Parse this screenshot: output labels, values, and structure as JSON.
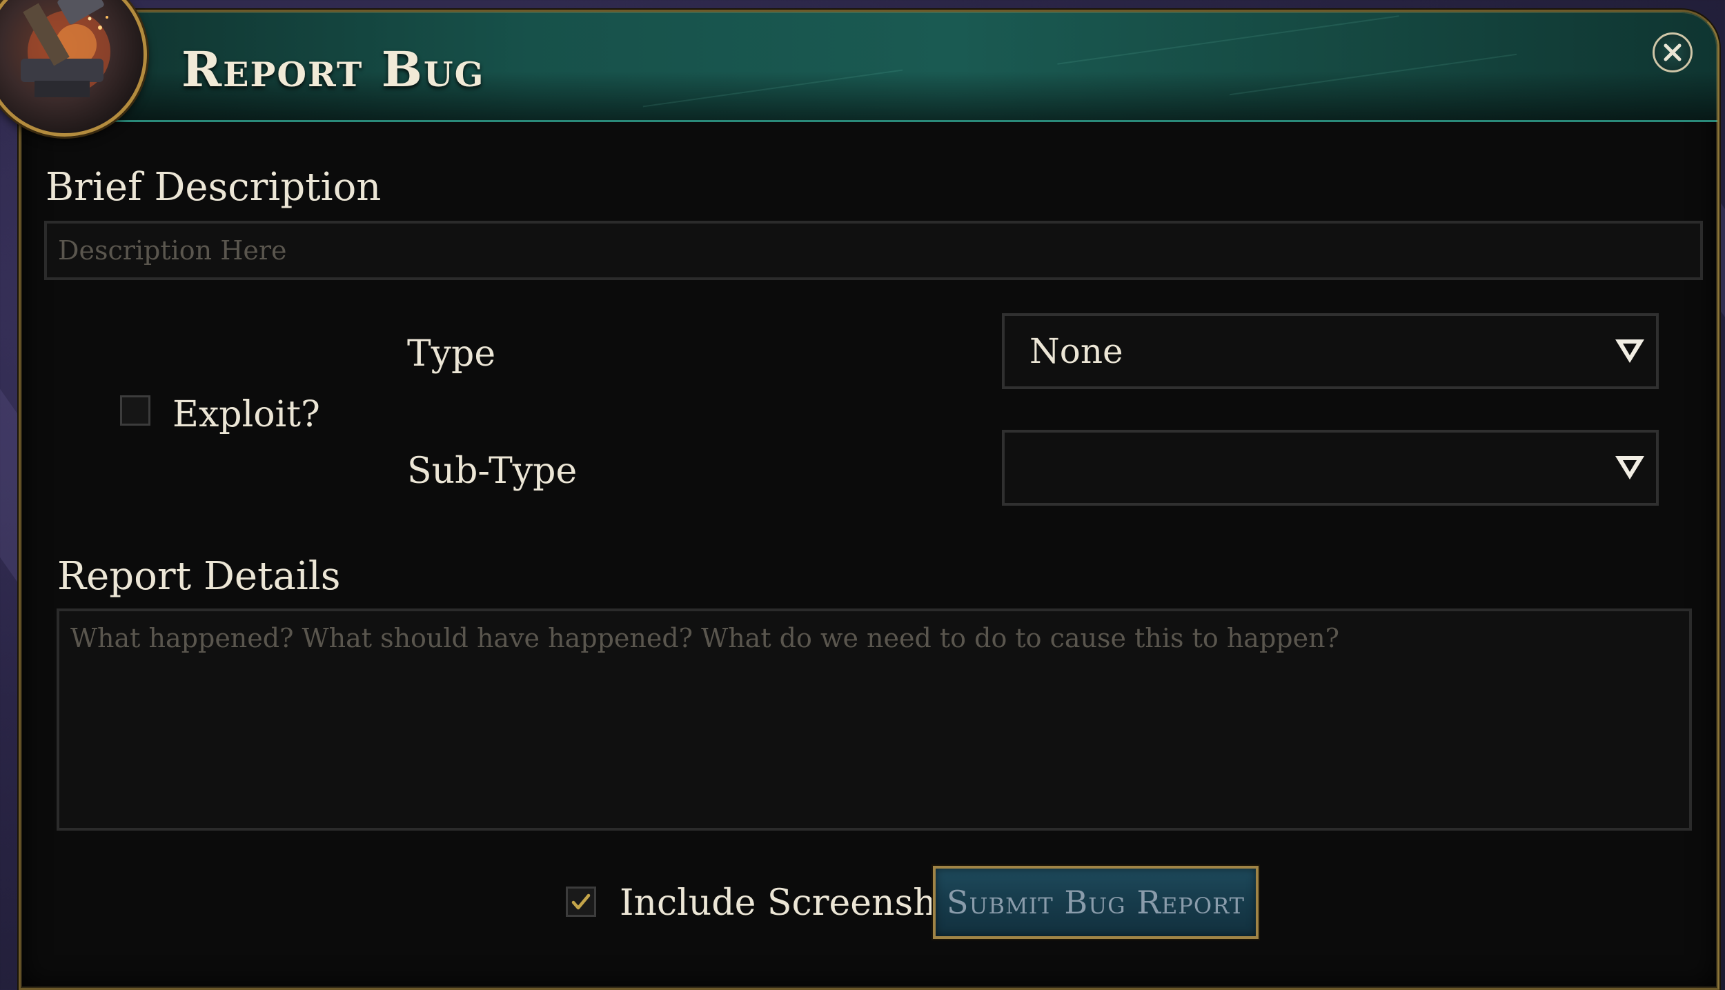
{
  "dialog": {
    "title": "Report Bug",
    "close_icon": "close-icon",
    "emblem_icon": "anvil-hammer-icon"
  },
  "form": {
    "brief_description": {
      "label": "Brief Description",
      "value": "",
      "placeholder": "Description Here"
    },
    "exploit": {
      "label": "Exploit?",
      "checked": false
    },
    "type": {
      "label": "Type",
      "selected": "None"
    },
    "sub_type": {
      "label": "Sub-Type",
      "selected": ""
    },
    "report_details": {
      "label": "Report Details",
      "value": "",
      "placeholder": "What happened? What should have happened? What do we need to do to cause this to happen?"
    },
    "include_screenshot": {
      "label": "Include Screenshot",
      "checked": true
    },
    "submit_label": "Submit Bug Report"
  },
  "colors": {
    "header_teal": "#17514a",
    "gold_border": "#a08446",
    "panel_bg": "#0b0b0b",
    "text": "#ece6d6",
    "checkmark": "#c4a54a"
  }
}
